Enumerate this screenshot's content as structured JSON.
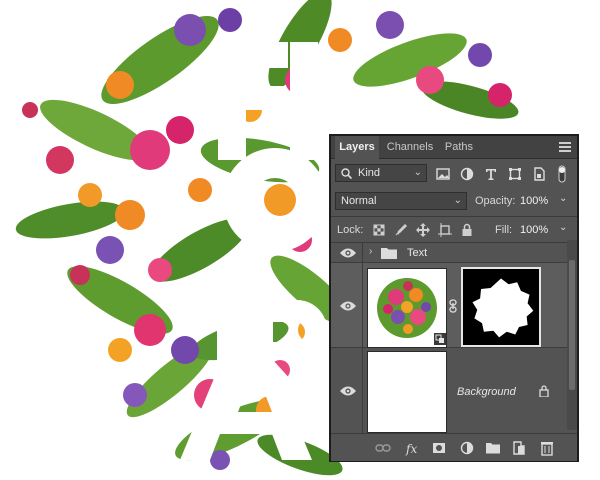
{
  "artwork": {
    "letters": [
      "F",
      "L",
      "O",
      "R",
      "A"
    ],
    "letter_color": "#ffffff"
  },
  "panel": {
    "tabs": [
      {
        "label": "Layers",
        "active": true
      },
      {
        "label": "Channels",
        "active": false
      },
      {
        "label": "Paths",
        "active": false
      }
    ],
    "filter": {
      "label": "Kind",
      "icons": [
        "image-filter-icon",
        "adjustment-filter-icon",
        "type-filter-icon",
        "shape-filter-icon",
        "smart-object-filter-icon"
      ]
    },
    "blend_mode": "Normal",
    "opacity": {
      "label": "Opacity:",
      "value": "100%"
    },
    "lock": {
      "label": "Lock:",
      "icons": [
        "lock-transparent-icon",
        "lock-image-icon",
        "lock-position-icon",
        "lock-artboard-icon",
        "lock-all-icon"
      ]
    },
    "fill": {
      "label": "Fill:",
      "value": "100%"
    },
    "layers": [
      {
        "name": "Text",
        "type": "group"
      },
      {
        "name": "",
        "type": "smart-object-with-mask"
      },
      {
        "name": "Background",
        "type": "background",
        "locked": true
      }
    ],
    "footer_icons": [
      "link-layers-icon",
      "fx-icon",
      "add-mask-icon",
      "adjustment-layer-icon",
      "new-group-icon",
      "new-layer-icon",
      "delete-layer-icon"
    ],
    "colors": {
      "panel": "#535353",
      "tabbar": "#424242",
      "border": "#1d1d1d"
    }
  }
}
